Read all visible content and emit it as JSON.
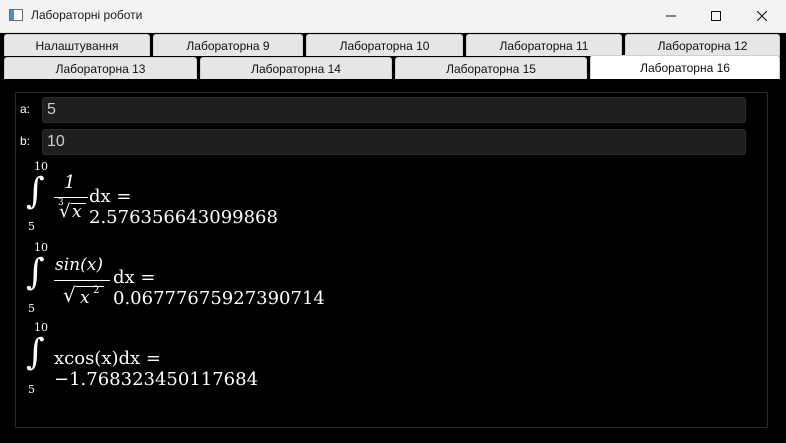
{
  "window": {
    "title": "Лабораторні роботи",
    "min_label": "",
    "max_label": "",
    "close_label": ""
  },
  "tabs": {
    "row1": [
      "Налаштування",
      "Лабораторна 9",
      "Лабораторна 10",
      "Лабораторна 11",
      "Лабораторна 12"
    ],
    "row2": [
      "Лабораторна 13",
      "Лабораторна 14",
      "Лабораторна 15",
      "Лабораторна 16"
    ],
    "active": "Лабораторна 16"
  },
  "inputs": {
    "a_label": "a:",
    "a_value": "5",
    "b_label": "b:",
    "b_value": "10"
  },
  "integrals": [
    {
      "upper": "10",
      "lower": "5",
      "integrand_num": "1",
      "integrand_den_root_index": "3",
      "integrand_den_radicand": "x",
      "tail": "dx = 2.576356643099868"
    },
    {
      "upper": "10",
      "lower": "5",
      "integrand_num": "sin(x)",
      "integrand_den_radicand_base": "x",
      "integrand_den_radicand_exp": "2",
      "tail": "dx = 0.06777675927390714"
    },
    {
      "upper": "10",
      "lower": "5",
      "expression": "xcos(x)dx = −1.768323450117684"
    }
  ],
  "colors": {
    "background": "#000000",
    "titlebar": "#f3f3f3",
    "tab_bg": "#e6e6e6",
    "tab_active_bg": "#ffffff",
    "field_bg": "#1f1f1f",
    "text": "#ffffff"
  }
}
